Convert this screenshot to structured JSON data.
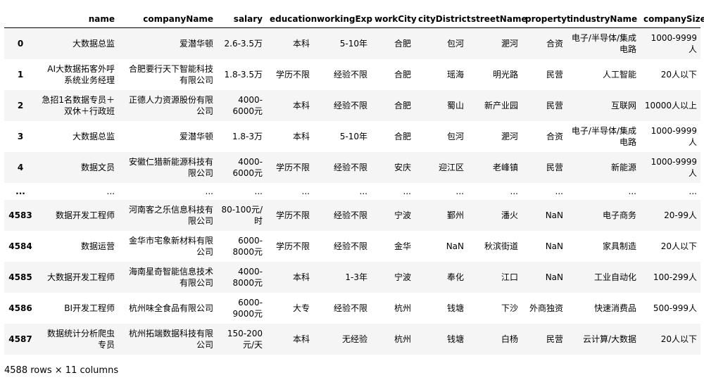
{
  "table": {
    "index_header": "",
    "columns": [
      "name",
      "companyName",
      "salary",
      "education",
      "workingExp",
      "workCity",
      "cityDistrict",
      "streetName",
      "propertyt",
      "industryName",
      "companySize"
    ],
    "rows": [
      {
        "index": "0",
        "cells": [
          "大数据总监",
          "爱潜华顿",
          "2.6-3.5万",
          "本科",
          "5-10年",
          "合肥",
          "包河",
          "淝河",
          "合资",
          "电子/半导体/集成电路",
          "1000-9999人"
        ]
      },
      {
        "index": "1",
        "cells": [
          "AI大数据拓客外呼系统业务经理",
          "合肥要行天下智能科技有限公司",
          "1.8-3.5万",
          "学历不限",
          "经验不限",
          "合肥",
          "瑶海",
          "明光路",
          "民营",
          "人工智能",
          "20人以下"
        ]
      },
      {
        "index": "2",
        "cells": [
          "急招1名数据专员＋双休＋行政班",
          "正德人力资源股份有限公司",
          "4000-6000元",
          "本科",
          "经验不限",
          "合肥",
          "蜀山",
          "新产业园",
          "民营",
          "互联网",
          "10000人以上"
        ]
      },
      {
        "index": "3",
        "cells": [
          "大数据总监",
          "爱潜华顿",
          "1.8-3万",
          "本科",
          "5-10年",
          "合肥",
          "包河",
          "淝河",
          "合资",
          "电子/半导体/集成电路",
          "1000-9999人"
        ]
      },
      {
        "index": "4",
        "cells": [
          "数据文员",
          "安徽仁猎新能源科技有限公司",
          "4000-6000元",
          "学历不限",
          "经验不限",
          "安庆",
          "迎江区",
          "老峰镇",
          "民营",
          "新能源",
          "1000-9999人"
        ]
      },
      {
        "index": "...",
        "cells": [
          "...",
          "...",
          "...",
          "...",
          "...",
          "...",
          "...",
          "...",
          "...",
          "...",
          "..."
        ],
        "ellipsis": true
      },
      {
        "index": "4583",
        "cells": [
          "数据开发工程师",
          "河南客之乐信息科技有限公司",
          "80-100元/时",
          "学历不限",
          "经验不限",
          "宁波",
          "鄞州",
          "潘火",
          "NaN",
          "电子商务",
          "20-99人"
        ]
      },
      {
        "index": "4584",
        "cells": [
          "数据运营",
          "金华市宅象新材料有限公司",
          "6000-8000元",
          "学历不限",
          "经验不限",
          "金华",
          "NaN",
          "秋滨街道",
          "NaN",
          "家具制造",
          "20人以下"
        ]
      },
      {
        "index": "4585",
        "cells": [
          "大数据开发工程师",
          "海南星奇智能信息技术有限公司",
          "4000-8000元",
          "本科",
          "1-3年",
          "宁波",
          "奉化",
          "江口",
          "NaN",
          "工业自动化",
          "100-299人"
        ]
      },
      {
        "index": "4586",
        "cells": [
          "BI开发工程师",
          "杭州味全食品有限公司",
          "6000-9000元",
          "大专",
          "经验不限",
          "杭州",
          "钱塘",
          "下沙",
          "外商独资",
          "快速消费品",
          "500-999人"
        ]
      },
      {
        "index": "4587",
        "cells": [
          "数据统计分析爬虫专员",
          "杭州拓端数据科技有限公司",
          "150-200元/天",
          "本科",
          "无经验",
          "杭州",
          "钱塘",
          "白杨",
          "民营",
          "云计算/大数据",
          "20人以下"
        ]
      }
    ]
  },
  "footer": {
    "shape_text": "4588 rows × 11 columns"
  }
}
